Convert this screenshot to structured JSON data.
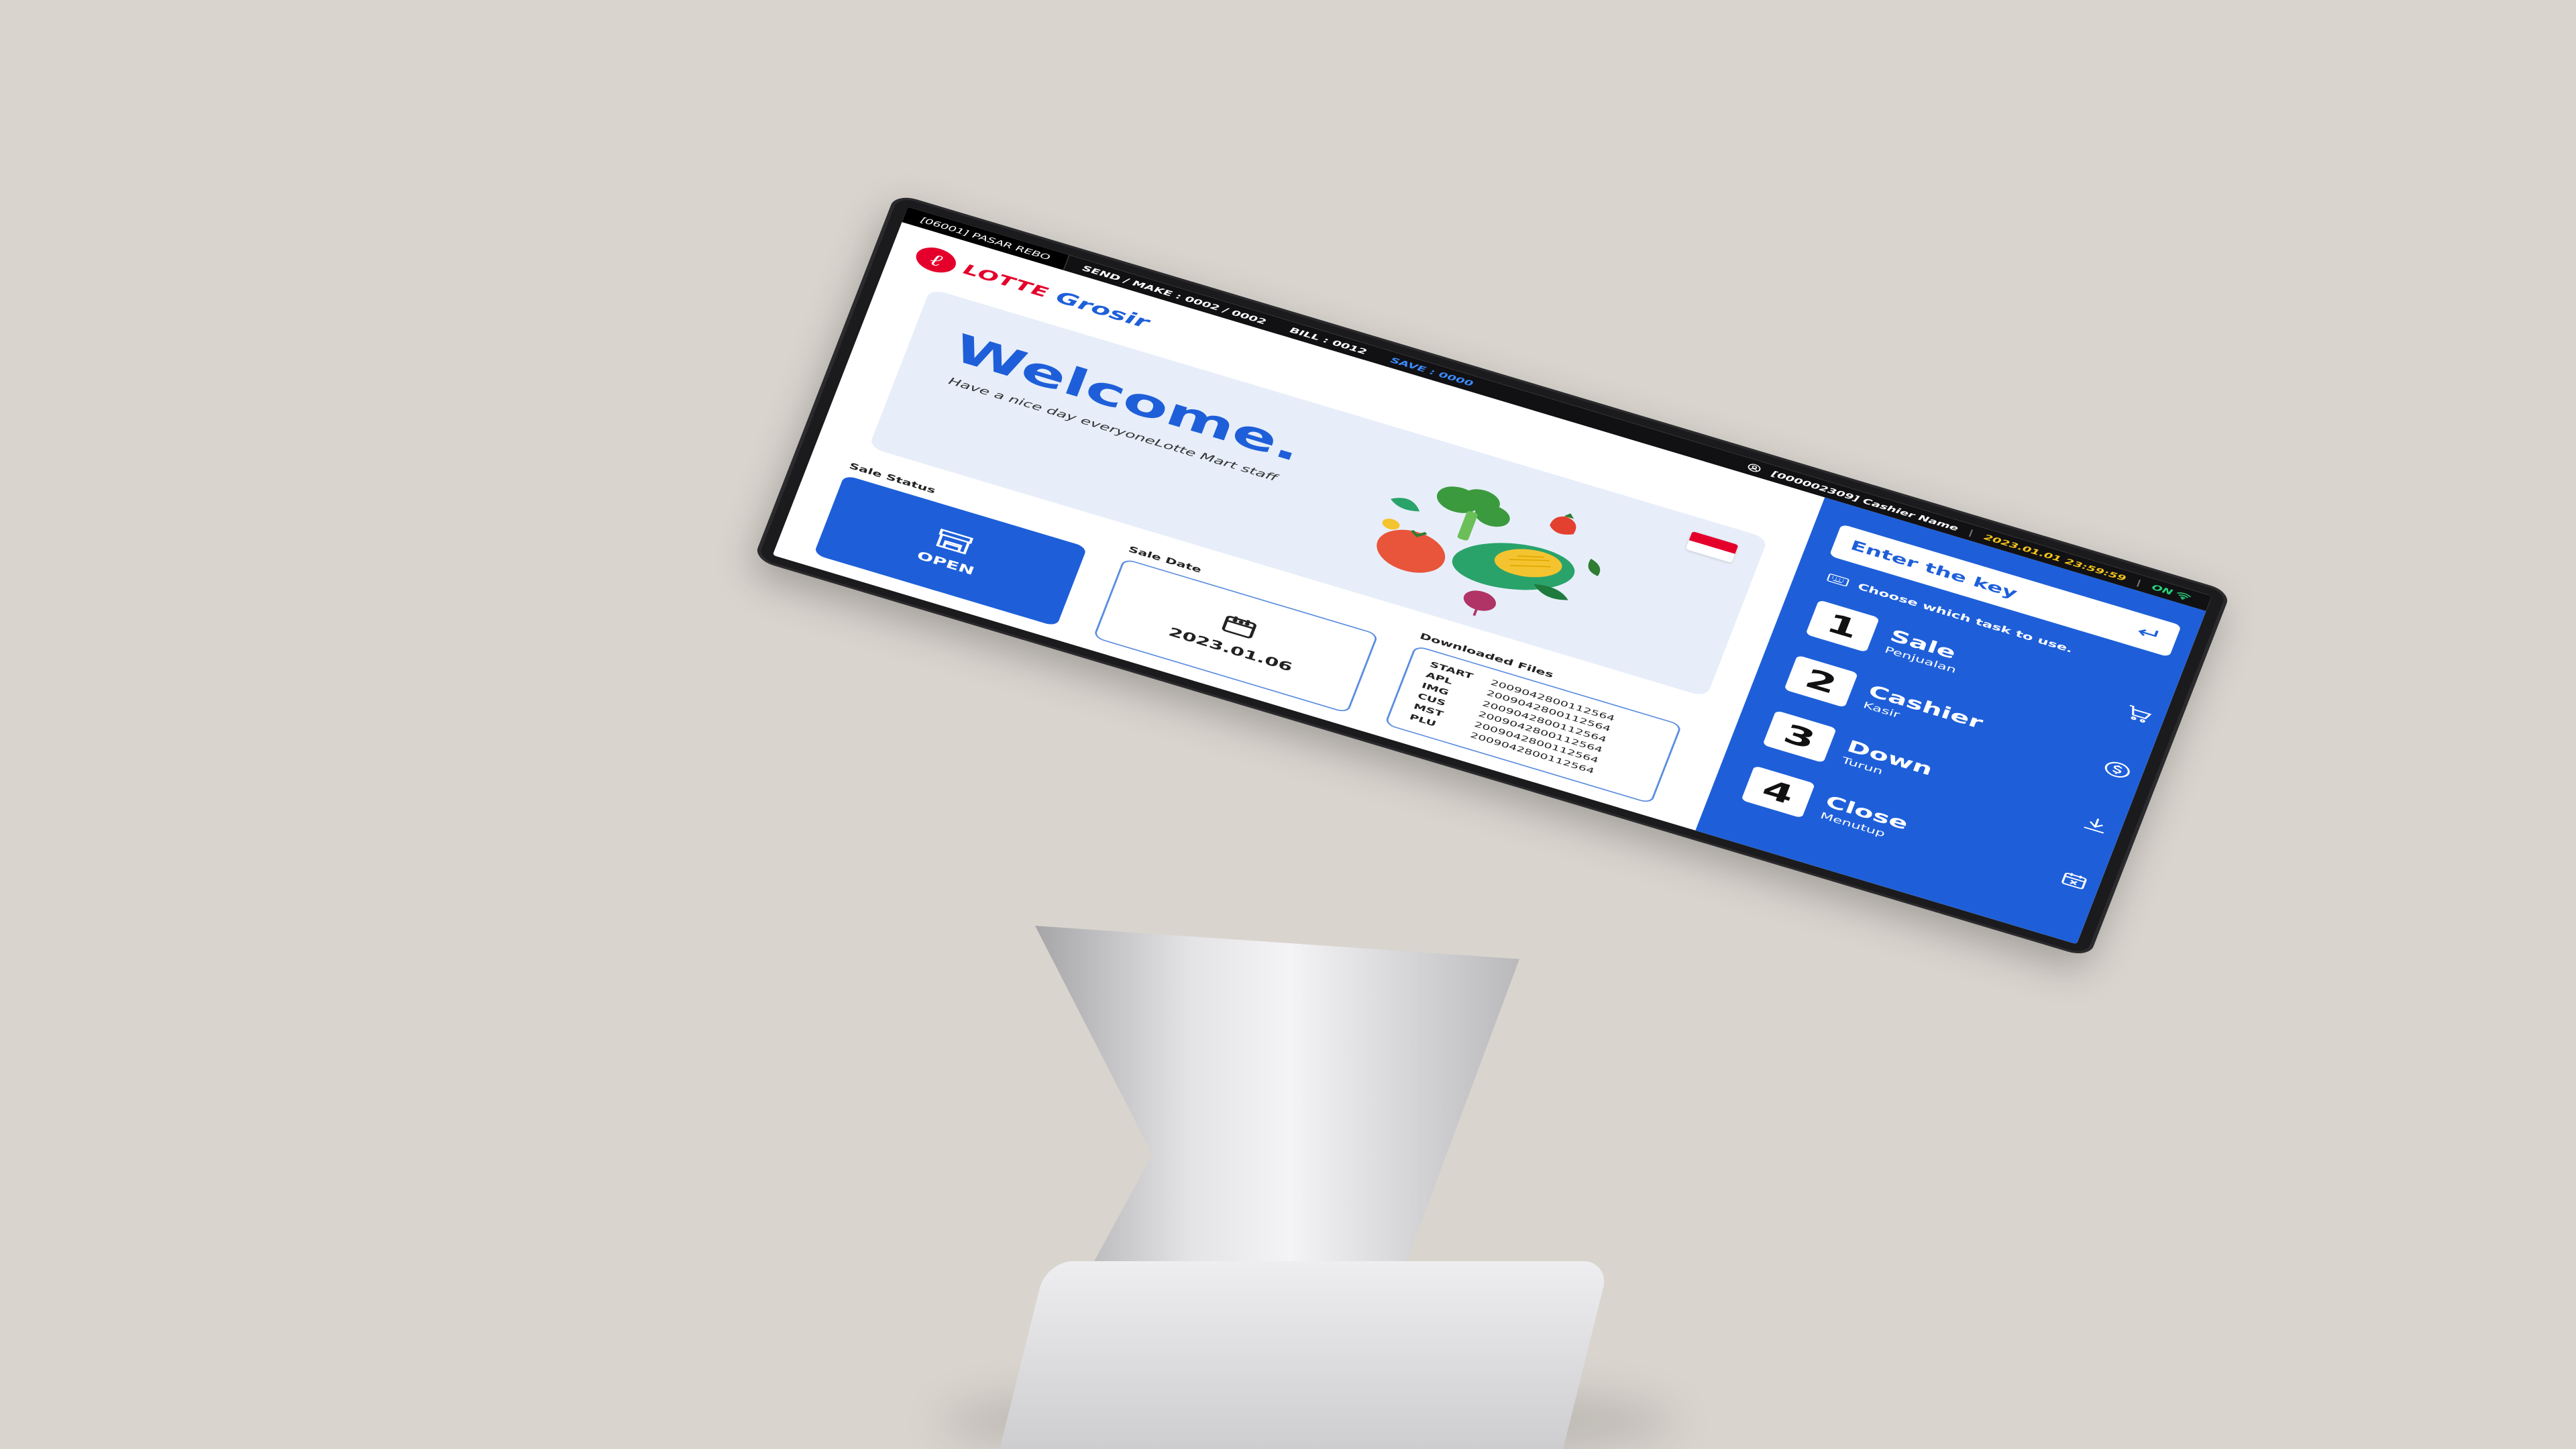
{
  "topbar": {
    "store": "[06001] PASAR REBO",
    "send_make": "SEND / MAKE : 0002 / 0002",
    "bill": "BILL : 0012",
    "save": "SAVE : 0000",
    "cashier": "[000002309] Cashier Name",
    "datetime": "2023.01.01 23:59:59",
    "status": "ON",
    "colors": {
      "datetime": "#f5c518",
      "status": "#29d17a",
      "save": "#3d8bff"
    }
  },
  "brand": {
    "mark": "ℓ",
    "lotte": "LOTTE",
    "grosir": "Grosir",
    "colors": {
      "lotte": "#e4002b",
      "grosir": "#1e5fd9"
    }
  },
  "banner": {
    "welcome": "Welcome.",
    "subtitle": "Have a nice day everyoneLotte Mart staff",
    "flag": "indonesia-flag-icon"
  },
  "sale_status": {
    "label": "Sale Status",
    "value": "OPEN",
    "icon": "store-icon"
  },
  "sale_date": {
    "label": "Sale Date",
    "value": "2023.01.06",
    "icon": "calendar-icon"
  },
  "downloaded_files": {
    "label": "Downloaded Files",
    "rows": [
      {
        "key": "START",
        "value": "2009042800112564"
      },
      {
        "key": "APL",
        "value": "2009042800112564"
      },
      {
        "key": "IMG",
        "value": "2009042800112564"
      },
      {
        "key": "CUS",
        "value": "2009042800112564"
      },
      {
        "key": "MST",
        "value": "2009042800112564"
      },
      {
        "key": "PLU",
        "value": "2009042800112564"
      }
    ]
  },
  "key_entry": {
    "placeholder": "Enter the key",
    "enter_icon": "enter-icon"
  },
  "hint": {
    "text": "Choose which task to use.",
    "icon": "keyboard-icon"
  },
  "tasks": [
    {
      "num": "1",
      "title": "Sale",
      "sub": "Penjualan",
      "icon": "cart-icon"
    },
    {
      "num": "2",
      "title": "Cashier",
      "sub": "Kasir",
      "icon": "dollar-icon"
    },
    {
      "num": "3",
      "title": "Down",
      "sub": "Turun",
      "icon": "download-icon"
    },
    {
      "num": "4",
      "title": "Close",
      "sub": "Menutup",
      "icon": "calendar-close-icon"
    }
  ],
  "accent": "#1e5fd9"
}
